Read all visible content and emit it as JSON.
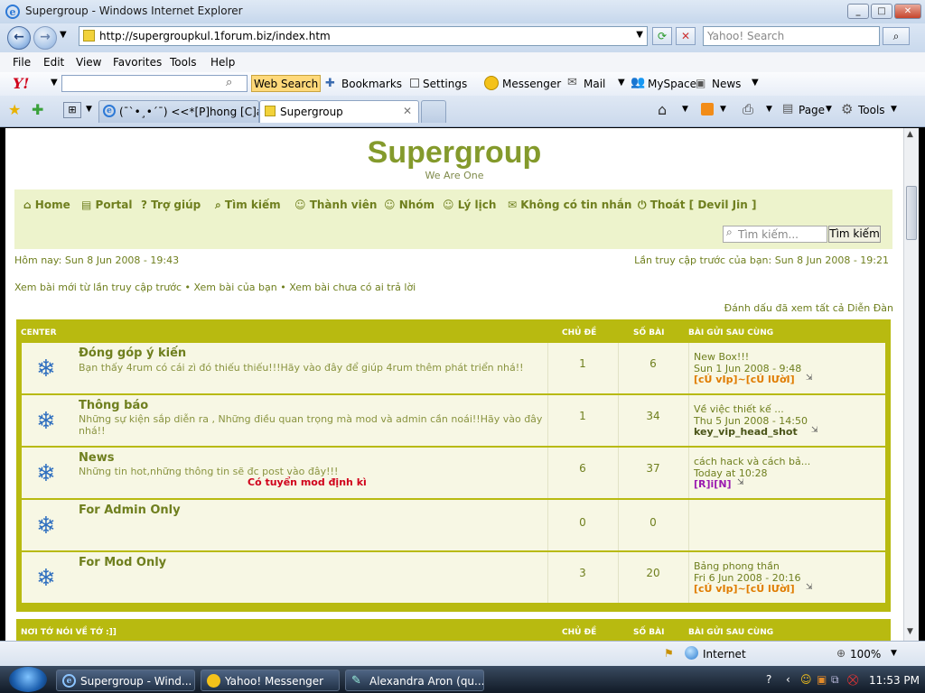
{
  "window": {
    "title": "Supergroup - Windows Internet Explorer"
  },
  "address": {
    "url": "http://supergroupkul.1forum.biz/index.htm",
    "search_placeholder": "Yahoo! Search"
  },
  "menu": [
    "File",
    "Edit",
    "View",
    "Favorites",
    "Tools",
    "Help"
  ],
  "yahoo_toolbar": {
    "logo": "Y!",
    "web_search": "Web Search",
    "bookmarks": "Bookmarks",
    "settings": "Settings",
    "messenger": "Messenger",
    "mail": "Mail",
    "myspace": "MySpace",
    "news": "News"
  },
  "tabs": [
    {
      "label": "(¯`•¸•´¯) <<*[P]hong [C]ách..."
    },
    {
      "label": "Supergroup"
    }
  ],
  "command_bar": {
    "page": "Page",
    "tools": "Tools"
  },
  "forum": {
    "title": "Supergroup",
    "description": "We Are One",
    "nav": [
      "Home",
      "Portal",
      "Trợ giúp",
      "Tìm kiếm",
      "Thành viên",
      "Nhóm",
      "Lý lịch",
      "Không có tin nhắn",
      "Thoát [ Devil Jin ]"
    ],
    "search_placeholder": "Tìm kiếm...",
    "search_button": "Tìm kiếm",
    "today": "Hôm nay: Sun 8 Jun 2008 - 19:43",
    "last_visit": "Lần truy cập trước của bạn: Sun 8 Jun 2008 - 19:21",
    "links": "Xem bài mới từ lần truy cập trước • Xem bài của bạn • Xem bài chưa có ai trả lời",
    "mark_read": "Đánh dấu đã xem tất cả Diễn Đàn",
    "headers": {
      "category": "CENTER",
      "topics": "CHỦ ĐỀ",
      "posts": "SỐ BÀI",
      "last_post": "BÀI GỬI SAU CÙNG"
    },
    "category2": "NƠI TỚ NÓI VỀ TỚ :]]",
    "rows": [
      {
        "title": "Đóng góp ý kiến",
        "desc": "Bạn thấy 4rum có cái zì đó thiếu thiếu!!!Hãy vào đây để giúp 4rum thêm phát triển nhá!!",
        "topics": "1",
        "posts": "6",
        "last_title": "New Box!!!",
        "last_date": "Sun 1 Jun 2008 - 9:48",
        "last_user": "[cÚ vIp]~[cÚ lƯờI]"
      },
      {
        "title": "Thông báo",
        "desc": "Những sự kiện sắp diễn ra , Những điều quan trọng mà mod và admin cần noái!!Hãy vào đây nhá!!",
        "topics": "1",
        "posts": "34",
        "last_title": "Về việc thiết kế ...",
        "last_date": "Thu 5 Jun 2008 - 14:50",
        "last_user": "key_vip_head_shot"
      },
      {
        "title": "News",
        "desc": "Những tin hot,những thông tin sẽ đc post vào đây!!!",
        "extra": "Có tuyển mod định kì",
        "topics": "6",
        "posts": "37",
        "last_title": "cách hack và cách bả...",
        "last_date": "Today at 10:28",
        "last_user": "[R]i[N]"
      },
      {
        "title": "For Admin Only",
        "desc": "",
        "topics": "0",
        "posts": "0",
        "last_title": "",
        "last_date": "",
        "last_user": ""
      },
      {
        "title": "For Mod Only",
        "desc": "",
        "topics": "3",
        "posts": "20",
        "last_title": "Bảng phong thần",
        "last_date": "Fri 6 Jun 2008 - 20:16",
        "last_user": "[cÚ vIp]~[cÚ lƯờI]"
      }
    ]
  },
  "status": {
    "zone": "Internet",
    "zoom": "100%"
  },
  "taskbar": {
    "items": [
      "Supergroup - Wind...",
      "Yahoo! Messenger",
      "Alexandra Aron (qu..."
    ],
    "clock": "11:53 PM"
  }
}
